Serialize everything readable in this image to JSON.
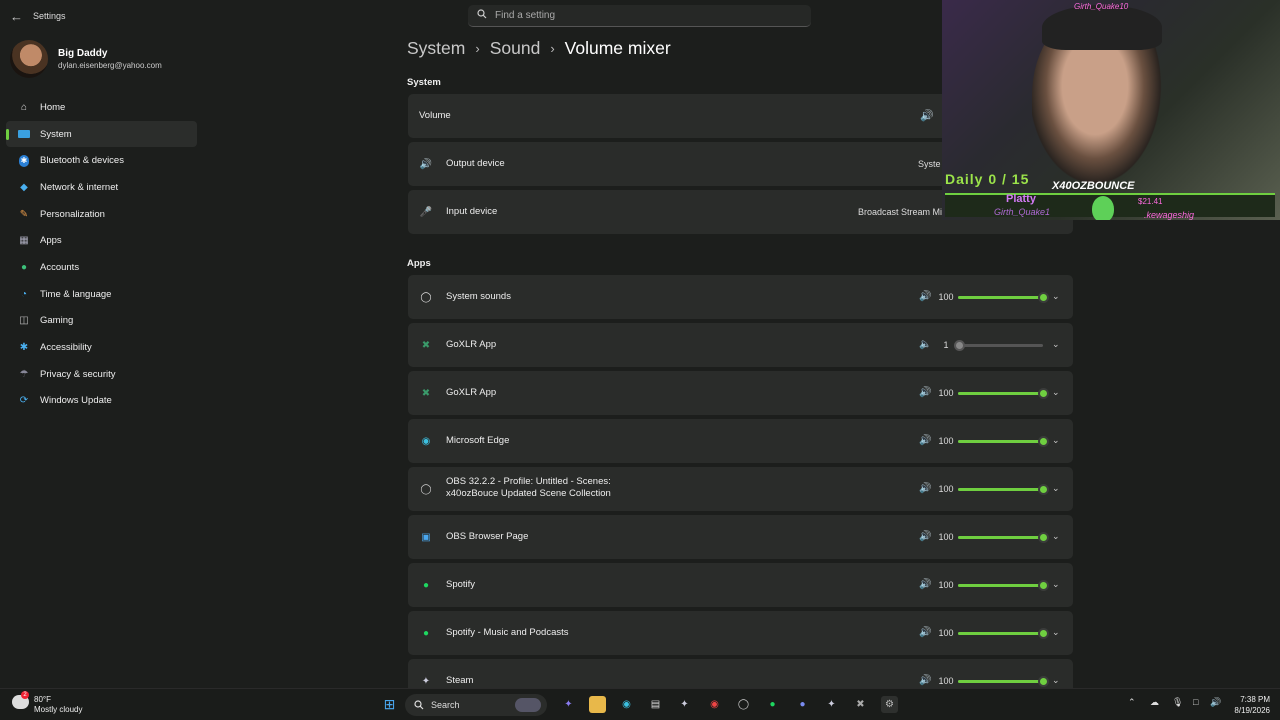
{
  "window": {
    "title": "Settings"
  },
  "search": {
    "placeholder": "Find a setting"
  },
  "profile": {
    "name": "Big Daddy",
    "email": "dylan.eisenberg@yahoo.com"
  },
  "sidebar": {
    "items": [
      {
        "label": "Home",
        "icon": "home-icon"
      },
      {
        "label": "System",
        "icon": "monitor-icon",
        "active": true
      },
      {
        "label": "Bluetooth & devices",
        "icon": "bluetooth-icon"
      },
      {
        "label": "Network & internet",
        "icon": "wifi-icon"
      },
      {
        "label": "Personalization",
        "icon": "brush-icon"
      },
      {
        "label": "Apps",
        "icon": "apps-icon"
      },
      {
        "label": "Accounts",
        "icon": "person-icon"
      },
      {
        "label": "Time & language",
        "icon": "globe-icon"
      },
      {
        "label": "Gaming",
        "icon": "controller-icon"
      },
      {
        "label": "Accessibility",
        "icon": "accessibility-icon"
      },
      {
        "label": "Privacy & security",
        "icon": "shield-icon"
      },
      {
        "label": "Windows Update",
        "icon": "update-icon"
      }
    ]
  },
  "breadcrumb": {
    "items": [
      "System",
      "Sound",
      "Volume mixer"
    ],
    "separator": "›"
  },
  "system_section": {
    "title": "System",
    "volume_label": "Volume",
    "output_label": "Output device",
    "output_value": "Syste",
    "input_label": "Input device",
    "input_value": "Broadcast Stream Mix (I"
  },
  "apps_section": {
    "title": "Apps",
    "apps": [
      {
        "name": "System sounds",
        "volume": "100",
        "level": 1.0,
        "icon": "speaker-icon"
      },
      {
        "name": "GoXLR App",
        "volume": "1",
        "level": 0.01,
        "icon": "goxlr-icon"
      },
      {
        "name": "GoXLR App",
        "volume": "100",
        "level": 1.0,
        "icon": "goxlr-icon"
      },
      {
        "name": "Microsoft Edge",
        "volume": "100",
        "level": 1.0,
        "icon": "edge-icon"
      },
      {
        "name": "OBS 32.2.2 - Profile: Untitled - Scenes:",
        "name2": "x40ozBouce Updated Scene Collection",
        "volume": "100",
        "level": 1.0,
        "icon": "obs-icon"
      },
      {
        "name": "OBS Browser Page",
        "volume": "100",
        "level": 1.0,
        "icon": "obs-browser-icon"
      },
      {
        "name": "Spotify",
        "volume": "100",
        "level": 1.0,
        "icon": "spotify-icon"
      },
      {
        "name": "Spotify - Music and Podcasts",
        "volume": "100",
        "level": 1.0,
        "icon": "spotify-icon"
      },
      {
        "name": "Steam",
        "volume": "100",
        "level": 1.0,
        "icon": "steam-icon"
      }
    ]
  },
  "overlay": {
    "daily": "Daily 0 / 15",
    "channel": "X40OZBOUNCE",
    "top_user": "Girth_Quake10",
    "platty": "Platty",
    "user": "Girth_Quake1",
    "amount": "$21.41",
    "user2": ".kewageshig"
  },
  "taskbar": {
    "weather_temp": "80°F",
    "weather_desc": "Mostly cloudy",
    "weather_badge": "2",
    "search_label": "Search",
    "time": "7:38 PM",
    "date": "8/19/2026"
  },
  "colors": {
    "accent": "#6fcf40",
    "background": "#1c1e1c",
    "card": "#2a2c2a"
  }
}
